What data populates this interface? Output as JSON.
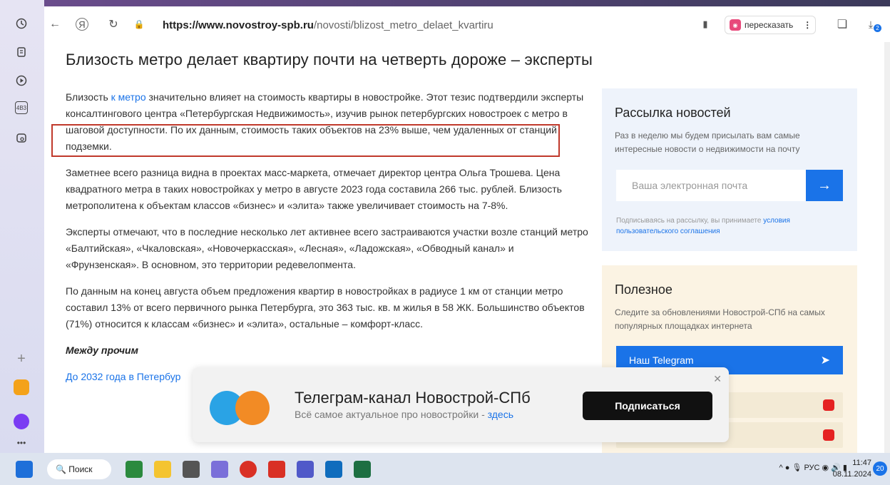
{
  "browser": {
    "url_host": "https://www.novostroy-spb.ru",
    "url_path": "/novosti/blizost_metro_delaet_kvartiru",
    "retell_label": "пересказать",
    "retell_icon": "retell-icon",
    "downloads_badge": "2"
  },
  "sidebar": {
    "icons": [
      "history-icon",
      "notes-icon",
      "play-icon",
      "video-badge-icon",
      "camera-icon"
    ],
    "video_badge": "4B3"
  },
  "article": {
    "title": "Близость метро делает квартиру почти на четверть дороже – эксперты",
    "p1_before": "Близость ",
    "p1_link": "к метро",
    "p1_after": " значительно влияет на стоимость квартиры в новостройке. Этот тезис подтвердили эксперты консалтингового центра «Петербургская Недвижимость», изучив рынок петербургских новостроек с метро в шаговой доступности. По их данным, стоимость таких объектов на 23% выше, чем удаленных от станций подземки.",
    "p2": "Заметнее всего разница видна в проектах масс-маркета, отмечает директор центра Ольга Трошева. Цена квадратного метра в таких новостройках у метро в августе 2023 года составила 266 тыс. рублей. Близость метрополитена к объектам классов «бизнес» и «элита» также увеличивает стоимость на 7-8%.",
    "p3": "Эксперты отмечают, что в последние несколько лет активнее всего застраиваются участки возле станций метро «Балтийская», «Чкаловская», «Новочеркасская», «Лесная», «Ладожская», «Обводный канал» и «Фрунзенская». В основном, это территории редевелопмента.",
    "p4": "По данным на конец августа объем предложения квартир в новостройках в радиусе 1 км от станции метро составил 13% от всего первичного рынка Петербурга, это 363 тыс. кв. м жилья в 58 ЖК. Большинство объектов (71%) относится к классам «бизнес» и «элита», остальные – комфорт-класс.",
    "by_the_way": "Между прочим",
    "related_link": "До 2032 года в Петербур"
  },
  "newsletter": {
    "title": "Рассылка новостей",
    "desc": "Раз в неделю мы будем присылать вам самые интересные новости о недвижимости на почту",
    "placeholder": "Ваша электронная почта",
    "note_before": "Подписываясь на рассылку, вы принимаете ",
    "note_link": "условия пользовательского соглашения"
  },
  "useful": {
    "title": "Полезное",
    "desc": "Следите за обновлениями Новострой-СПб на самых популярных площадках интернета",
    "telegram_button": "Наш Telegram"
  },
  "popup": {
    "title": "Телеграм-канал Новострой-СПб",
    "subtitle": "Всё самое актуальное про новостройки - ",
    "subtitle_link": "здесь",
    "subscribe": "Подписаться"
  },
  "taskbar": {
    "search": "Поиск",
    "lang": "РУС",
    "time": "11:47",
    "date": "08.11.2024",
    "notifications": "20"
  }
}
